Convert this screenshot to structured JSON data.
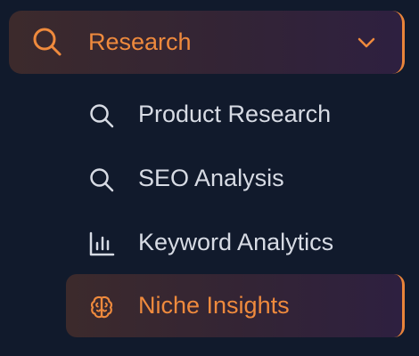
{
  "colors": {
    "background": "#111a2c",
    "accent": "#ef8a3d",
    "text": "#d7dbe4"
  },
  "section": {
    "label": "Research",
    "icon": "search-icon",
    "expanded": true,
    "chevron_icon": "chevron-down-icon"
  },
  "items": [
    {
      "label": "Product Research",
      "icon": "search-icon",
      "active": false
    },
    {
      "label": "SEO Analysis",
      "icon": "search-icon",
      "active": false
    },
    {
      "label": "Keyword Analytics",
      "icon": "bar-chart-icon",
      "active": false
    },
    {
      "label": "Niche Insights",
      "icon": "brain-icon",
      "active": true
    }
  ]
}
